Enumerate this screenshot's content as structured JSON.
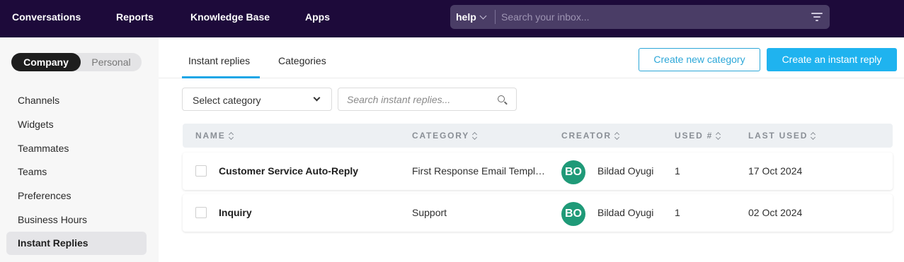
{
  "topnav": {
    "items": [
      "Conversations",
      "Reports",
      "Knowledge Base",
      "Apps"
    ],
    "search_scope": "help",
    "search_placeholder": "Search your inbox..."
  },
  "sidebar": {
    "toggle": {
      "active": "Company",
      "inactive": "Personal"
    },
    "items": [
      "Channels",
      "Widgets",
      "Teammates",
      "Teams",
      "Preferences",
      "Business Hours",
      "Instant Replies"
    ],
    "active_item": "Instant Replies"
  },
  "main": {
    "tabs": [
      "Instant replies",
      "Categories"
    ],
    "active_tab": "Instant replies",
    "buttons": {
      "create_category": "Create new category",
      "create_reply": "Create an instant reply"
    },
    "filter": {
      "category_select": "Select category",
      "search_placeholder": "Search instant replies..."
    },
    "table": {
      "columns": [
        "NAME",
        "CATEGORY",
        "CREATOR",
        "USED #",
        "LAST USED"
      ],
      "rows": [
        {
          "name": "Customer Service Auto-Reply",
          "category": "First Response Email Templates",
          "avatar": "BO",
          "creator": "Bildad Oyugi",
          "used": "1",
          "last_used": "17 Oct 2024"
        },
        {
          "name": "Inquiry",
          "category": "Support",
          "avatar": "BO",
          "creator": "Bildad Oyugi",
          "used": "1",
          "last_used": "02 Oct 2024"
        }
      ]
    }
  },
  "colors": {
    "topbar": "#1d0a3a",
    "accent": "#1fb3ef",
    "avatar": "#1f9a78"
  }
}
